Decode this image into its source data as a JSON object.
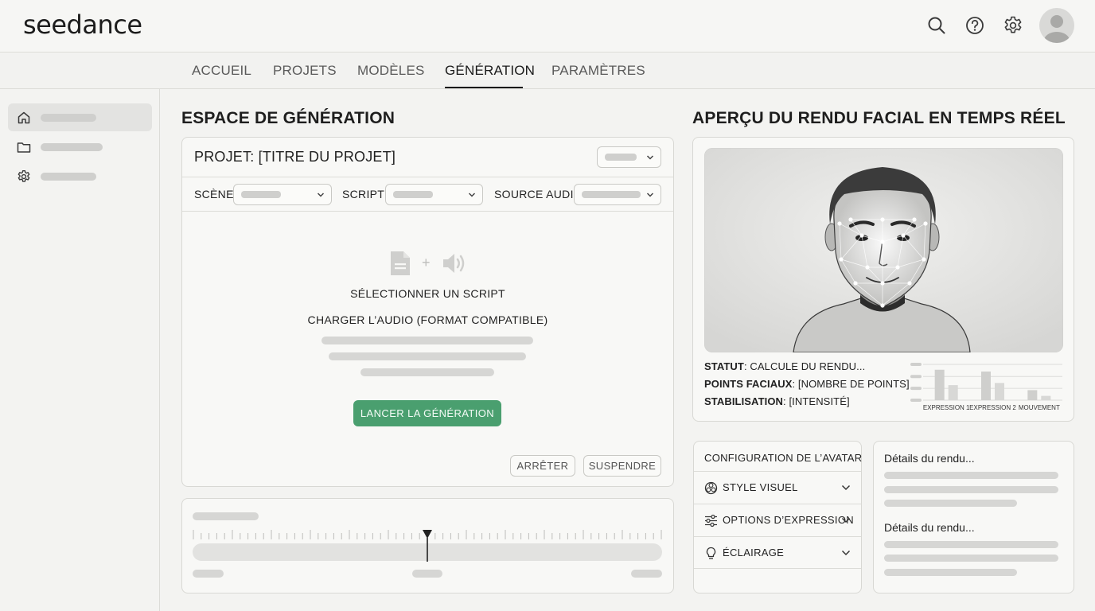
{
  "app": {
    "logo": "seedance"
  },
  "header_icons": [
    "search-icon",
    "help-icon",
    "gear-icon",
    "avatar-icon"
  ],
  "nav": {
    "tabs": [
      {
        "label": "ACCUEIL"
      },
      {
        "label": "PROJETS"
      },
      {
        "label": "MODÈLES"
      },
      {
        "label": "GÉNÉRATION",
        "active": true
      },
      {
        "label": "PARAMÈTRES"
      }
    ]
  },
  "sidebar": {
    "icons": [
      "home-icon",
      "folder-icon",
      "gear-icon"
    ]
  },
  "generation": {
    "title": "ESPACE DE GÉNÉRATION",
    "project_label": "PROJET: [TITRE DU PROJET]",
    "scene_label": "SCÈNE",
    "script_label": "SCRIPT",
    "audio_label": "SOURCE AUDIO",
    "drop_plus": "+",
    "select_script": "SÉLECTIONNER UN SCRIPT",
    "load_audio": "CHARGER L’AUDIO (FORMAT COMPATIBLE)",
    "start_button": "LANCER LA GÉNÉRATION",
    "stop_button": "ARRÊTER",
    "pause_button": "SUSPENDRE"
  },
  "timeline": {
    "playhead_position": 0.5
  },
  "preview": {
    "title": "APERÇU DU RENDU FACIAL EN TEMPS RÉEL",
    "status_key": "STATUT",
    "status_value": ": CALCULE DU RENDU...",
    "points_key": "POINTS FACIAUX",
    "points_value": ": [NOMBRE DE POINTS]",
    "stab_key": "STABILISATION",
    "stab_value": ": [INTENSITÉ]"
  },
  "chart_data": {
    "type": "bar",
    "categories": [
      "EXPRESSION 1",
      "EXPRESSION 2",
      "MOUVEMENT"
    ],
    "series": [
      {
        "values": [
          0.85,
          0.8,
          0.28
        ]
      },
      {
        "values": [
          0.42,
          0.48,
          0.12
        ]
      }
    ],
    "ylim": [
      0,
      1
    ],
    "grid": true
  },
  "avatar_config": {
    "title": "CONFIGURATION DE L’AVATAR",
    "items": [
      {
        "label": "STYLE VISUEL",
        "icon": "palette-icon"
      },
      {
        "label": "OPTIONS D’EXPRESSION",
        "icon": "sliders-icon"
      },
      {
        "label": "ÉCLAIRAGE",
        "icon": "lightbulb-icon"
      }
    ]
  },
  "details": {
    "title_1": "Détails du rendu...",
    "title_2": "Détails du rendu..."
  },
  "colors": {
    "accent": "#4a9f6f",
    "background": "#f3f3f1"
  }
}
